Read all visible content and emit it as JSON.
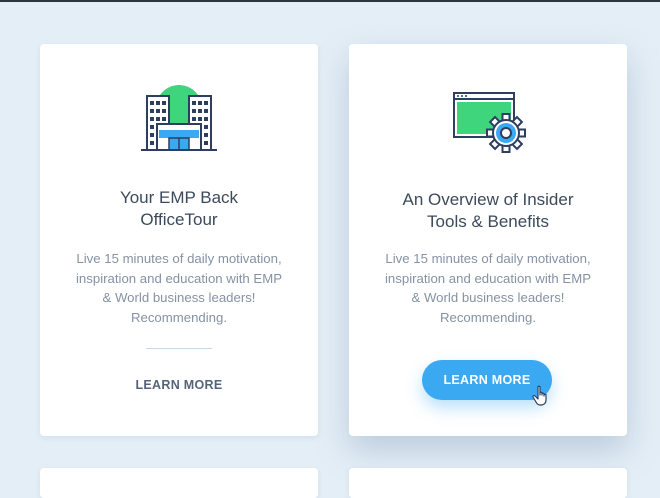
{
  "cards": [
    {
      "icon": "office-building-icon",
      "title_line1": "Your EMP Back",
      "title_line2": "OfficeTour",
      "desc_lines": [
        "Live 15 minutes of daily motivation,",
        "inspiration and education with EMP",
        "& World business leaders!",
        "Recommending."
      ],
      "cta": "LEARN MORE"
    },
    {
      "icon": "browser-settings-icon",
      "title_line1": "An Overview of Insider",
      "title_line2": "Tools & Benefits",
      "desc_lines": [
        "Live 15 minutes of daily motivation,",
        "inspiration and education with EMP",
        "& World business leaders!",
        "Recommending."
      ],
      "cta": "LEARN MORE"
    }
  ],
  "colors": {
    "background": "#e4eef6",
    "card": "#ffffff",
    "accent_green": "#3fd57c",
    "accent_blue": "#3aa9f2",
    "icon_stroke": "#2d3e5e",
    "title": "#3c4a5c",
    "body_text": "#8592a3"
  }
}
